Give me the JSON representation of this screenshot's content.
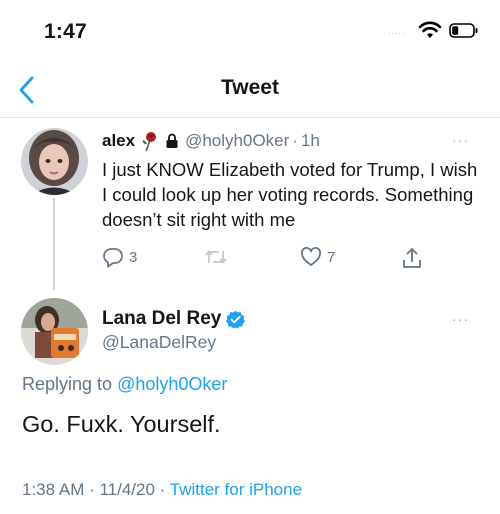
{
  "status_bar": {
    "time": "1:47",
    "signal": "....."
  },
  "nav": {
    "title": "Tweet"
  },
  "reply_tweet": {
    "name": "alex",
    "handle": "@holyh0Oker",
    "separator": "·",
    "time": "1h",
    "text": "I just KNOW Elizabeth voted for Trump, I wish I could look up her voting records. Something doesn’t sit right with me",
    "reply_count": "3",
    "like_count": "7",
    "more": "···"
  },
  "main_tweet": {
    "name": "Lana Del Rey",
    "handle": "@LanaDelRey",
    "replying_prefix": "Replying to",
    "replying_to": "@holyh0Oker",
    "text": "Go. Fuxk. Yourself.",
    "timestamp": "1:38 AM · 11/4/20 ·",
    "source": "Twitter for iPhone",
    "more": "···"
  },
  "colors": {
    "accent": "#1da1f2",
    "secondary_text": "#657786",
    "primary_text": "#14171a",
    "divider": "#e1e8ed"
  },
  "icons": [
    "back-icon",
    "wifi-icon",
    "battery-icon",
    "rose-icon",
    "lock-icon",
    "reply-icon",
    "retweet-icon",
    "like-icon",
    "share-icon",
    "verified-icon",
    "more-icon"
  ]
}
